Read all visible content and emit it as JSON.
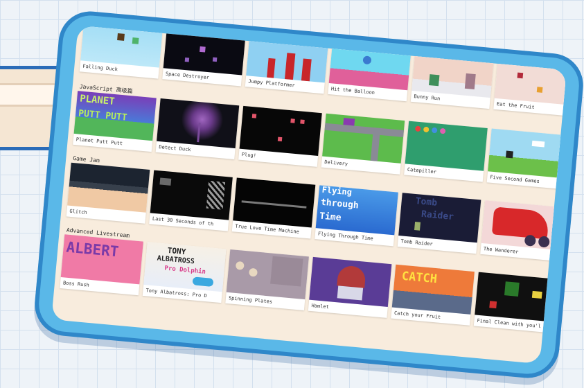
{
  "rows": [
    {
      "title": "",
      "games": [
        {
          "caption": "Falling Duck"
        },
        {
          "caption": "Space Destroyer"
        },
        {
          "caption": "Jumpy Platformer"
        },
        {
          "caption": "Hit the Balloon"
        },
        {
          "caption": "Bunny Run"
        },
        {
          "caption": "Eat the Fruit"
        }
      ]
    },
    {
      "title": "JavaScript 高级篇",
      "games": [
        {
          "caption": "Planet Putt Putt",
          "art_text": [
            "PLANET",
            "PUTT PUTT"
          ]
        },
        {
          "caption": "Detect Duck"
        },
        {
          "caption": "Plug!"
        },
        {
          "caption": "Delivery"
        },
        {
          "caption": "Catepiller"
        },
        {
          "caption": "Five Second Games"
        }
      ]
    },
    {
      "title": "Game Jam",
      "games": [
        {
          "caption": "Glitch"
        },
        {
          "caption": "Last 30 Seconds of th"
        },
        {
          "caption": "True Love Time Machine"
        },
        {
          "caption": "Flying Through Time",
          "art_text": [
            "Flying",
            "through",
            "Time"
          ]
        },
        {
          "caption": "Tomb Raider",
          "art_text": [
            "Tomb",
            "Raider"
          ]
        },
        {
          "caption": "The Wanderer"
        }
      ]
    },
    {
      "title": "Advanced Livestream",
      "games": [
        {
          "caption": "Boss Rush",
          "art_text": [
            "ALBERT"
          ]
        },
        {
          "caption": "Tony Albatross: Pro D",
          "art_text": [
            "TONY",
            "ALBATROSS",
            "Pro Dolphin"
          ]
        },
        {
          "caption": "Spinning Plates"
        },
        {
          "caption": "Hamlet"
        },
        {
          "caption": "Catch your Fruit",
          "art_text": [
            "CATCH"
          ]
        },
        {
          "caption": "Final Clean with you'l"
        }
      ]
    }
  ],
  "icons": {
    "more": "chevron-right-icon"
  },
  "colors": {
    "frame": "#5ab8e8",
    "frame_border": "#2f87c9",
    "panel": "#f8ecdd",
    "grid_bg": "#eef3f8"
  }
}
